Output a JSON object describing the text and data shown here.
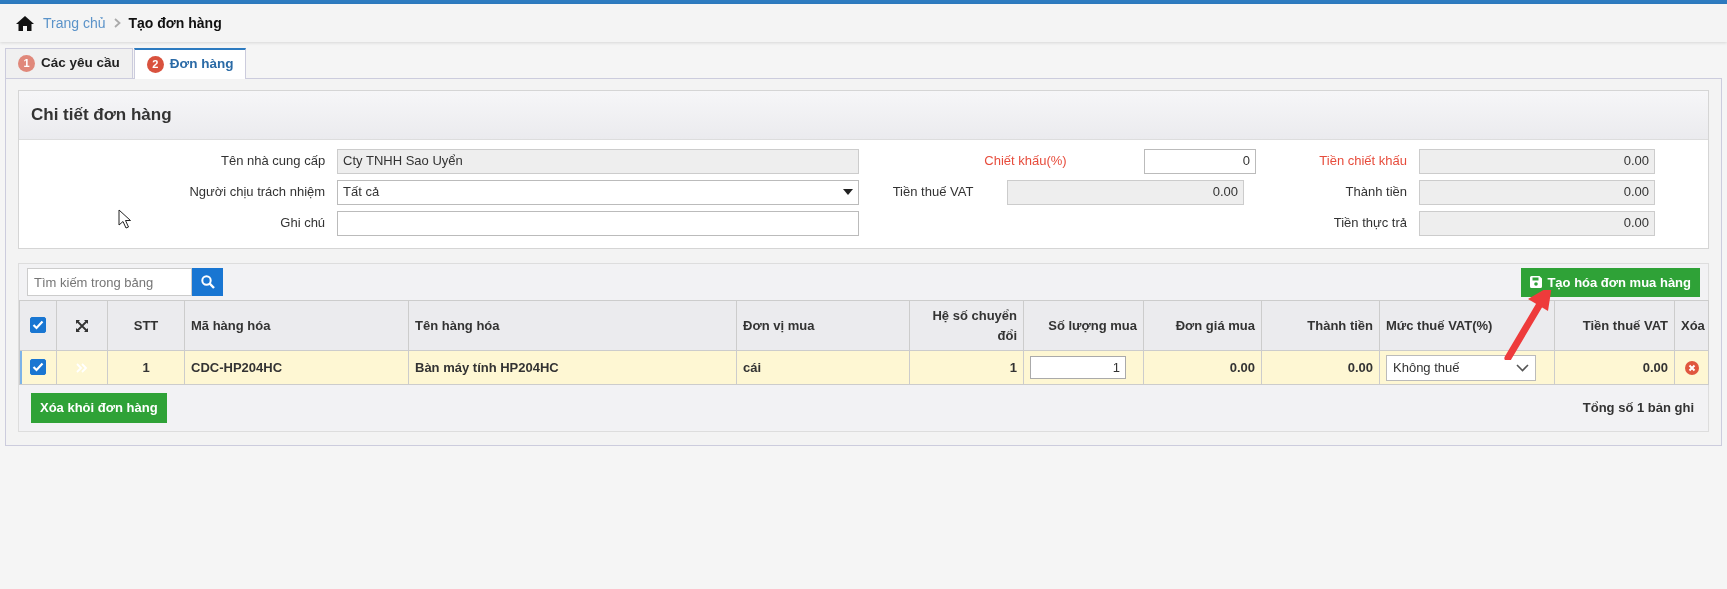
{
  "breadcrumb": [
    {
      "label": "Trang chủ",
      "kind": "link"
    },
    {
      "label": "Tạo đơn hàng",
      "kind": "current"
    }
  ],
  "tabs": [
    {
      "number": "1",
      "label": "Các yêu cầu",
      "selected": false
    },
    {
      "number": "2",
      "label": "Đơn hàng",
      "selected": true
    }
  ],
  "detail": {
    "title": "Chi tiết đơn hàng",
    "left": [
      {
        "label": "Tên nhà cung cấp",
        "kind": "readonly",
        "value": "Cty TNHH Sao Uyển"
      },
      {
        "label": "Người chịu trách nhiệm",
        "kind": "select",
        "value": "Tất cả"
      },
      {
        "label": "Ghi chú",
        "kind": "text"
      }
    ],
    "middle": [
      {
        "label": "Chiết khấu(%)",
        "kind": "number",
        "value": "0",
        "color": "#e74c3c"
      },
      {
        "label": "Tiền thuế VAT",
        "kind": "readonly",
        "value": "0.00",
        "color": "#333333"
      }
    ],
    "right": [
      {
        "label": "Tiền chiết khấu",
        "kind": "readonly",
        "value": "0.00",
        "color": "#e74c3c"
      },
      {
        "label": "Thành tiền",
        "kind": "readonly",
        "value": "0.00",
        "color": "#333333"
      },
      {
        "label": "Tiền thực trả",
        "kind": "readonly",
        "value": "0.00",
        "color": "#333333"
      }
    ]
  },
  "grid": {
    "search_placeholder": "Tìm kiếm trong bảng",
    "create_button": "Tạo hóa đơn mua hàng",
    "all_checked": true,
    "columns": [
      "STT",
      "Mã hàng hóa",
      "Tên hàng hóa",
      "Đơn vị mua",
      "Hệ số chuyển đổi",
      "Số lượng mua",
      "Đơn giá mua",
      "Thành tiền",
      "Mức thuế VAT(%)",
      "Tiền thuế VAT",
      "Xóa"
    ],
    "rows": [
      {
        "checked": true,
        "stt": "1",
        "code": "CDC-HP204HC",
        "name": "Bàn máy tính HP204HC",
        "unit": "cái",
        "factor": "1",
        "qty": "1",
        "price": "0.00",
        "total": "0.00",
        "vat": "Không thuế",
        "vat_amount": "0.00"
      }
    ],
    "remove_button": "Xóa khỏi đơn hàng",
    "total_text": "Tổng số 1 bản ghi"
  }
}
